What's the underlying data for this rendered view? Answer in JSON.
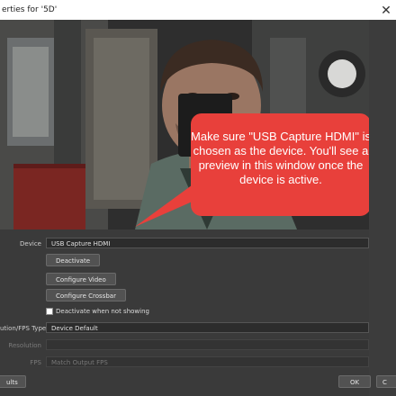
{
  "window": {
    "title": "erties for '5D'",
    "close_glyph": "✕"
  },
  "preview": {
    "callout_text": "Make sure \"USB Capture HDMI\" is chosen as the device. You'll see a preview in this window once the device is active.",
    "callout_color": "#e8403b"
  },
  "form": {
    "device_label": "Device",
    "device_value": "USB Capture HDMI",
    "deactivate_button": "Deactivate",
    "configure_video_button": "Configure Video",
    "configure_crossbar_button": "Configure Crossbar",
    "deactivate_checkbox_label": "Deactivate when not showing",
    "resolution_fps_type_label": "ution/FPS Type",
    "resolution_fps_type_value": "Device Default",
    "resolution_label": "Resolution",
    "resolution_value": "",
    "fps_label": "FPS",
    "fps_value": "Match Output FPS"
  },
  "footer": {
    "defaults_button": "ults",
    "ok_button": "OK",
    "cancel_button": "C"
  }
}
